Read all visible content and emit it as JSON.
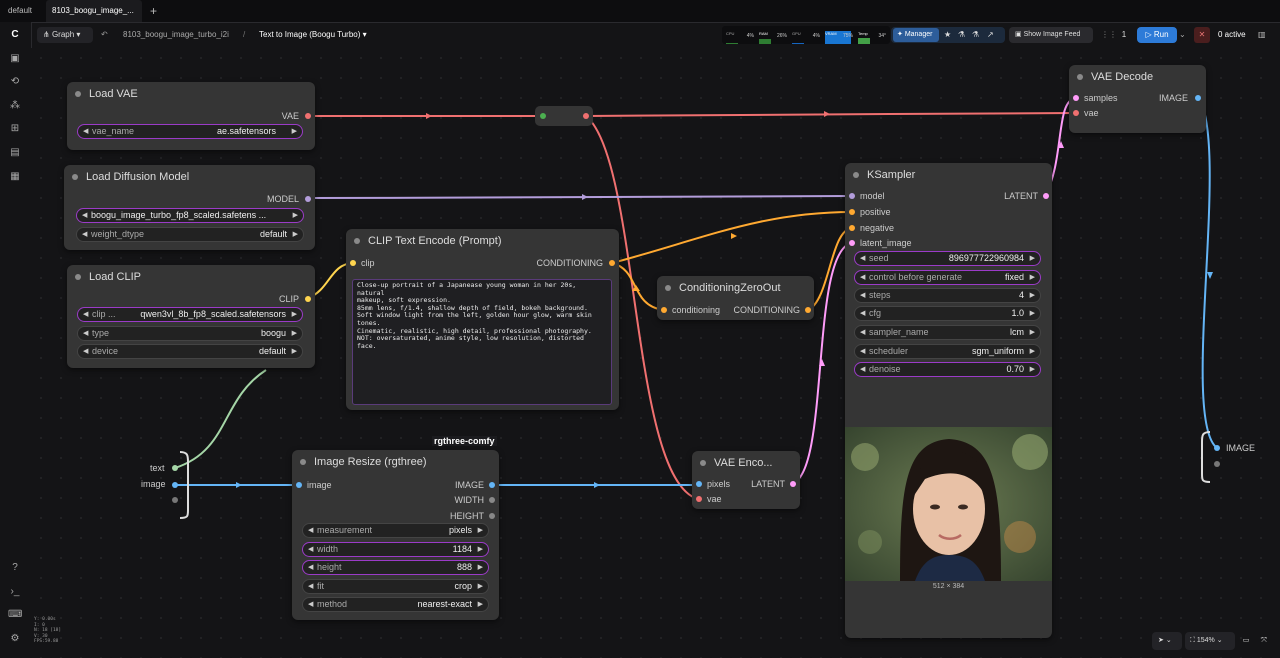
{
  "tabs": [
    {
      "label": "default"
    },
    {
      "label": "8103_boogu_image_..."
    }
  ],
  "toolbar": {
    "graph_label": "Graph",
    "breadcrumb_file": "8103_boogu_image_turbo_i2i",
    "breadcrumb_sep": "/",
    "workflow_title": "Text to Image (Boogu Turbo)",
    "meters": [
      {
        "name": "CPU",
        "percent": "4%",
        "level": 0.04
      },
      {
        "name": "RAM",
        "percent": "26%",
        "level": 0.26
      },
      {
        "name": "GPU",
        "percent": "4%",
        "level": 0.04
      },
      {
        "name": "VRAM",
        "percent": "75%",
        "level": 0.75
      },
      {
        "name": "Temp",
        "percent": "34°",
        "level": 0.34
      }
    ],
    "manager_label": "Manager",
    "image_feed_label": "Show Image Feed",
    "queue_count": "1",
    "run_label": "Run",
    "active_label": "0 active",
    "zoom_label": "154%"
  },
  "nodes": {
    "load_vae": {
      "title": "Load VAE",
      "output": "VAE",
      "widgets": [
        {
          "name": "vae_name",
          "value": "ae.safetensors"
        }
      ]
    },
    "load_diffusion": {
      "title": "Load Diffusion Model",
      "output": "MODEL",
      "widgets": [
        {
          "name": "",
          "value": "boogu_image_turbo_fp8_scaled.safetens ..."
        },
        {
          "name": "weight_dtype",
          "value": "default"
        }
      ]
    },
    "load_clip": {
      "title": "Load CLIP",
      "output": "CLIP",
      "widgets": [
        {
          "name": "clip ...",
          "value": "qwen3vl_8b_fp8_scaled.safetensors"
        },
        {
          "name": "type",
          "value": "boogu"
        },
        {
          "name": "device",
          "value": "default"
        }
      ]
    },
    "clip_text": {
      "title": "CLIP Text Encode (Prompt)",
      "input": "clip",
      "output": "CONDITIONING",
      "prompt": "Close-up portrait of a Japanease young woman in her 20s, natural\nmakeup, soft expression.\n85mm lens, f/1.4, shallow depth of field, bokeh background.\nSoft window light from the left, golden hour glow, warm skin\ntones.\nCinematic, realistic, high detail, professional photography.\nNOT: oversaturated, anime style, low resolution, distorted face."
    },
    "cond_zero": {
      "title": "ConditioningZeroOut",
      "input": "conditioning",
      "output": "CONDITIONING"
    },
    "ksampler": {
      "title": "KSampler",
      "inputs": [
        "model",
        "positive",
        "negative",
        "latent_image"
      ],
      "output": "LATENT",
      "widgets": [
        {
          "name": "seed",
          "value": "896977722960984"
        },
        {
          "name": "control before generate",
          "value": "fixed"
        },
        {
          "name": "steps",
          "value": "4"
        },
        {
          "name": "cfg",
          "value": "1.0"
        },
        {
          "name": "sampler_name",
          "value": "lcm"
        },
        {
          "name": "scheduler",
          "value": "sgm_uniform"
        },
        {
          "name": "denoise",
          "value": "0.70"
        }
      ],
      "preview_size": "512 × 384"
    },
    "vae_decode": {
      "title": "VAE Decode",
      "inputs": [
        "samples",
        "vae"
      ],
      "output": "IMAGE"
    },
    "vae_encode": {
      "title": "VAE Enco...",
      "inputs": [
        "pixels",
        "vae"
      ],
      "output": "LATENT"
    },
    "image_resize": {
      "title": "Image Resize (rgthree)",
      "badge": "rgthree-comfy",
      "input": "image",
      "outputs": [
        "IMAGE",
        "WIDTH",
        "HEIGHT"
      ],
      "widgets": [
        {
          "name": "measurement",
          "value": "pixels"
        },
        {
          "name": "width",
          "value": "1184"
        },
        {
          "name": "height",
          "value": "888"
        },
        {
          "name": "fit",
          "value": "crop"
        },
        {
          "name": "method",
          "value": "nearest-exact"
        }
      ]
    },
    "load_image_group": {
      "outputs": [
        "text",
        "image"
      ]
    },
    "output_group": {
      "input": "IMAGE"
    }
  },
  "colors": {
    "vae": "#f07070",
    "model": "#b39ddb",
    "clip": "#ffd54f",
    "conditioning": "#ffa931",
    "latent": "#ff9cf9",
    "image": "#64b5f6",
    "text": "#a5d6a7",
    "accent": "#2d7bd8",
    "widget_highlight": "#9b3bc8"
  },
  "stats": [
    "Y: 0.00s",
    "I: 0",
    "N: 18 [18]",
    "V: 30",
    "FPS:59.88"
  ]
}
